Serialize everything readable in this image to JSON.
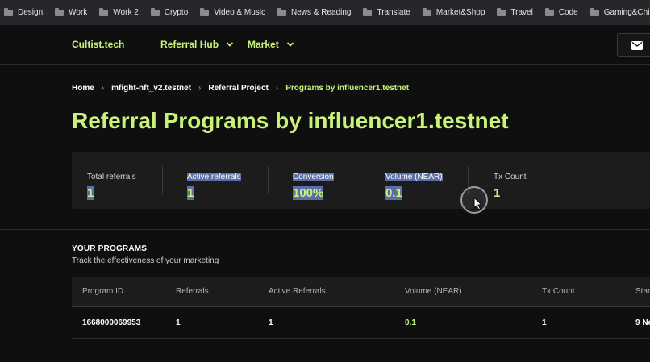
{
  "bookmarks": [
    "Design",
    "Work",
    "Work 2",
    "Crypto",
    "Video & Music",
    "News & Reading",
    "Translate",
    "Market&Shop",
    "Travel",
    "Code",
    "Gaming&Chill"
  ],
  "nav": {
    "brand": "Cultist.tech",
    "referral_hub": "Referral Hub",
    "market": "Market",
    "mail_icon": "mail-icon"
  },
  "breadcrumb": [
    "Home",
    "mfight-nft_v2.testnet",
    "Referral Project",
    "Programs by influencer1.testnet"
  ],
  "page_title": "Referral Programs by influencer1.testnet",
  "stats": [
    {
      "label": "Total referrals",
      "value": "1"
    },
    {
      "label": "Active referrals",
      "value": "1"
    },
    {
      "label": "Conversion",
      "value": "100%"
    },
    {
      "label": "Volume (NEAR)",
      "value": "0.1"
    },
    {
      "label": "Tx Count",
      "value": "1"
    }
  ],
  "programs": {
    "title": "YOUR PROGRAMS",
    "subtitle": "Track the effectiveness of your marketing",
    "columns": [
      "Program ID",
      "Referrals",
      "Active Referrals",
      "Volume (NEAR)",
      "Tx Count",
      "Star"
    ],
    "rows": [
      [
        "1668000069953",
        "1",
        "1",
        "0.1",
        "1",
        "9 Ne"
      ]
    ]
  },
  "colors": {
    "accent": "#c9f27b",
    "background": "#0f0f0f",
    "panel": "#1c1c1c",
    "selection": "#5b6ea8"
  }
}
